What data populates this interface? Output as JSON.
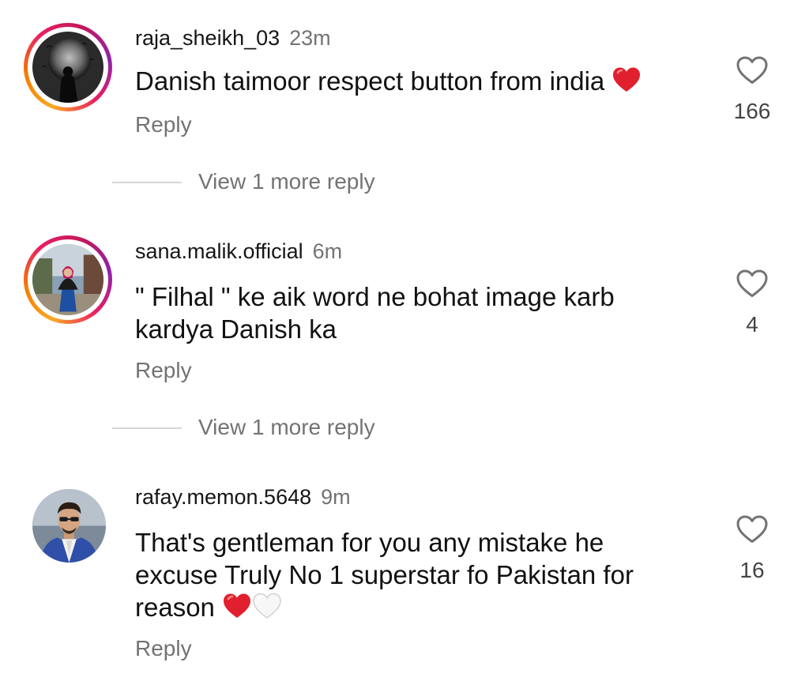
{
  "comments": [
    {
      "username": "raja_sheikh_03",
      "time": "23m",
      "text": "Danish taimoor respect button from india",
      "emoji_icons": [
        "red-heart-emoji"
      ],
      "reply_label": "Reply",
      "like_count": "166",
      "view_more_label": "View 1 more reply",
      "avatar_ring": true
    },
    {
      "username": "sana.malik.official",
      "time": "6m",
      "text_lines": [
        "\" Filhal \" ke aik word ne bohat image karb",
        "kardya Danish ka"
      ],
      "reply_label": "Reply",
      "like_count": "4",
      "view_more_label": "View 1 more reply",
      "avatar_ring": true
    },
    {
      "username": "rafay.memon.5648",
      "time": "9m",
      "text_lines": [
        "That's gentleman for you any mistake he",
        "excuse  Truly No 1 superstar fo Pakistan for",
        "reason"
      ],
      "emoji_icons": [
        "red-heart-emoji",
        "white-heart-emoji"
      ],
      "reply_label": "Reply",
      "like_count": "16",
      "avatar_ring": false
    }
  ],
  "icons": {
    "like": "heart-outline-icon"
  },
  "colors": {
    "secondary_text": "#737373",
    "primary_text": "#111111",
    "story_ring_start": "#f9a825",
    "story_ring_end": "#8e24aa",
    "heart_emoji": "#e0202e"
  }
}
